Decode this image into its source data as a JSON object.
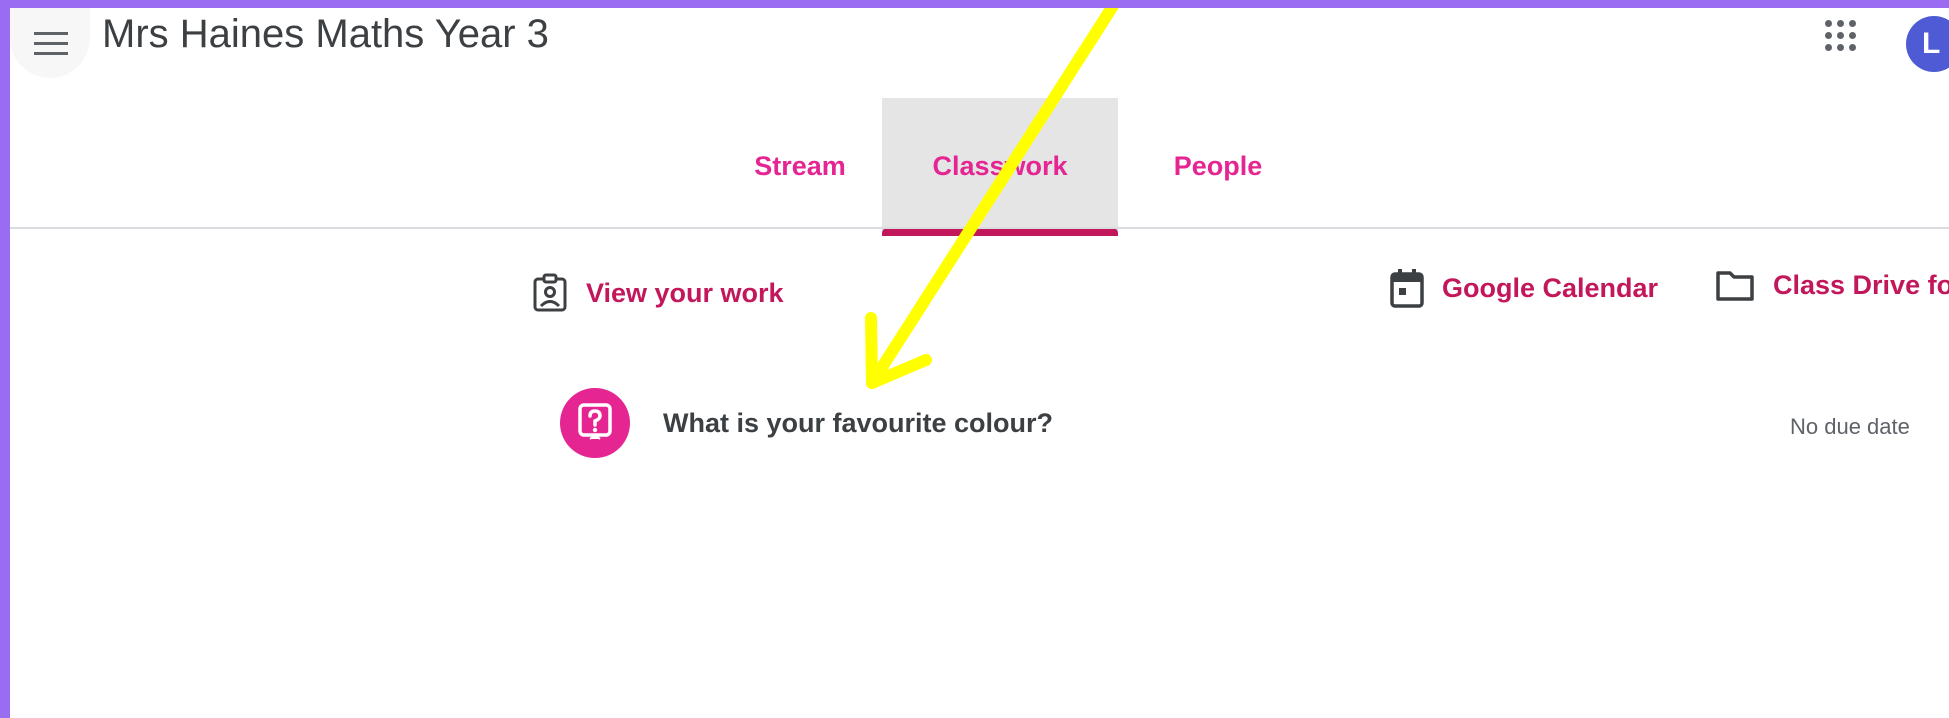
{
  "header": {
    "title": "Mrs Haines Maths Year 3",
    "avatar_initial": "L",
    "menu_icon": "hamburger-menu-icon",
    "apps_icon": "apps-grid-icon"
  },
  "tabs": [
    {
      "label": "Stream",
      "active": false
    },
    {
      "label": "Classwork",
      "active": true
    },
    {
      "label": "People",
      "active": false
    }
  ],
  "toolbar": {
    "view_work_label": "View your work",
    "calendar_label": "Google Calendar",
    "drive_label": "Class Drive fo"
  },
  "classwork": {
    "items": [
      {
        "title": "What is your favourite colour?",
        "due": "No due date",
        "icon": "question-icon"
      }
    ]
  },
  "colors": {
    "frame": "#9a6cf2",
    "accent": "#e52592",
    "accent_dark": "#c2185b",
    "annotation_arrow": "#ffff00",
    "avatar": "#4f5bd5"
  }
}
